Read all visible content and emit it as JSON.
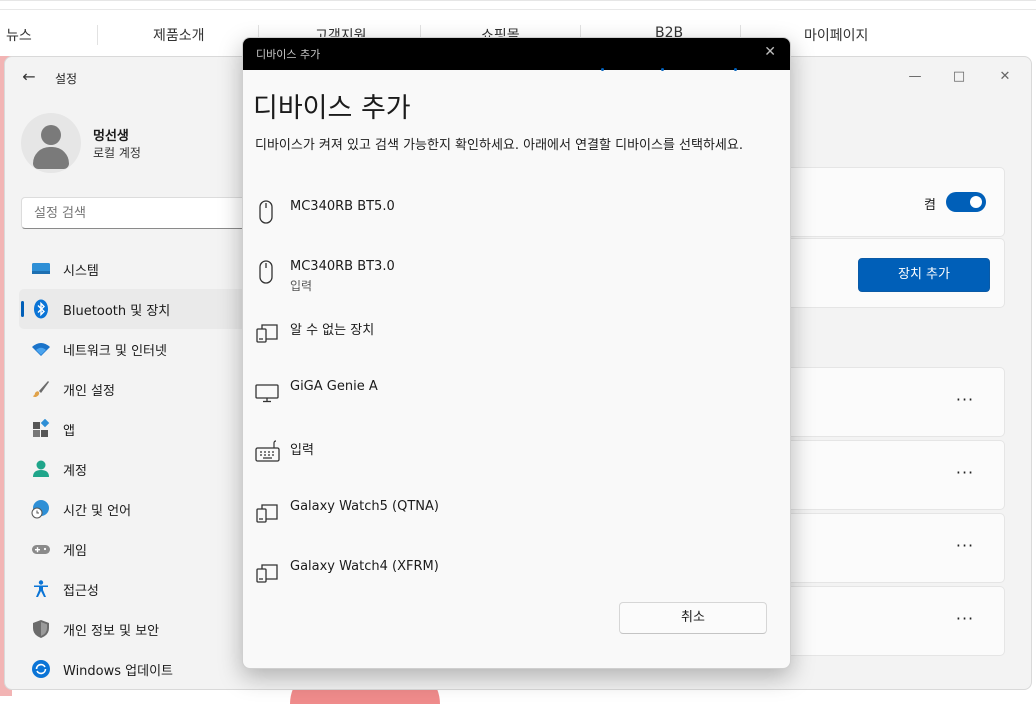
{
  "website_nav": {
    "items": [
      "뉴스",
      "제품소개",
      "고객지원",
      "쇼핑몰",
      "B2B",
      "마이페이지"
    ]
  },
  "settings": {
    "app_title": "설정",
    "profile": {
      "name": "멍선생",
      "account_type": "로컬 계정"
    },
    "search_placeholder": "설정 검색",
    "nav": [
      {
        "label": "시스템",
        "icon": "monitor-icon"
      },
      {
        "label": "Bluetooth 및 장치",
        "icon": "bluetooth-icon",
        "selected": true
      },
      {
        "label": "네트워크 및 인터넷",
        "icon": "wifi-icon"
      },
      {
        "label": "개인 설정",
        "icon": "brush-icon"
      },
      {
        "label": "앱",
        "icon": "apps-icon"
      },
      {
        "label": "계정",
        "icon": "person-icon"
      },
      {
        "label": "시간 및 언어",
        "icon": "globe-clock-icon"
      },
      {
        "label": "게임",
        "icon": "gamepad-icon"
      },
      {
        "label": "접근성",
        "icon": "accessibility-icon"
      },
      {
        "label": "개인 정보 및 보안",
        "icon": "shield-icon"
      },
      {
        "label": "Windows 업데이트",
        "icon": "update-icon"
      }
    ],
    "bluetooth_state": "켬",
    "add_device_label": "장치 추가",
    "more_label": "···"
  },
  "dialog": {
    "window_title": "디바이스 추가",
    "heading": "디바이스 추가",
    "description": "디바이스가 켜져 있고 검색 가능한지 확인하세요. 아래에서 연결할 디바이스를 선택하세요.",
    "devices": [
      {
        "name": "MC340RB BT5.0",
        "sub": "",
        "icon": "mouse-icon"
      },
      {
        "name": "MC340RB BT3.0",
        "sub": "입력",
        "icon": "mouse-icon"
      },
      {
        "name": "알 수 없는 장치",
        "sub": "",
        "icon": "devices-icon"
      },
      {
        "name": "GiGA Genie A",
        "sub": "",
        "icon": "monitor-icon"
      },
      {
        "name": "입력",
        "sub": "",
        "icon": "keyboard-icon"
      },
      {
        "name": "Galaxy Watch5 (QTNA)",
        "sub": "",
        "icon": "devices-icon"
      },
      {
        "name": "Galaxy Watch4 (XFRM)",
        "sub": "",
        "icon": "devices-icon"
      }
    ],
    "cancel_label": "취소"
  },
  "colors": {
    "accent": "#005fb8",
    "dialog_titlebar": "#000000"
  }
}
